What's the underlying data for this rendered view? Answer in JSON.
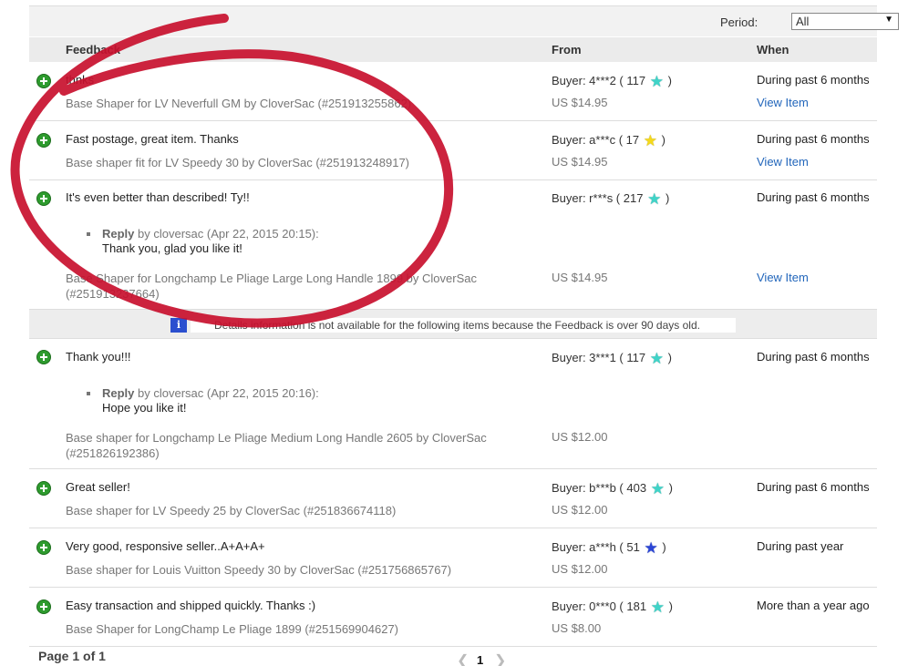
{
  "period": {
    "label": "Period:",
    "selected": "All"
  },
  "columns": {
    "feedback": "Feedback",
    "from": "From",
    "when": "When"
  },
  "rows": [
    {
      "comment": "thnks",
      "item": "Base Shaper for LV Neverfull GM by CloverSac (#251913255862)",
      "buyer": "Buyer: 4***2 ( 117",
      "buyer_close": ")",
      "star": "turquoise",
      "price": "US $14.95",
      "when": "During past 6 months",
      "link": "View Item"
    },
    {
      "comment": "Fast postage, great item. Thanks",
      "item": "Base shaper fit for LV Speedy 30 by CloverSac (#251913248917)",
      "buyer": "Buyer: a***c ( 17",
      "buyer_close": ")",
      "star": "yellow",
      "price": "US $14.95",
      "when": "During past 6 months",
      "link": "View Item"
    },
    {
      "comment": "It's even better than described! Ty!!",
      "reply_label": "Reply",
      "reply_meta": " by cloversac (Apr 22, 2015 20:15):",
      "reply_text": "Thank you, glad you like it!",
      "item": "Base Shaper for Longchamp Le Pliage Large Long Handle 1899 by CloverSac (#251913237664)",
      "buyer": "Buyer: r***s ( 217",
      "buyer_close": ")",
      "star": "turquoise",
      "price": "US $14.95",
      "when": "During past 6 months",
      "link": "View Item"
    },
    {
      "comment": "Thank you!!!",
      "reply_label": "Reply",
      "reply_meta": " by cloversac (Apr 22, 2015 20:16):",
      "reply_text": "Hope you like it!",
      "item": "Base shaper for Longchamp Le Pliage Medium Long Handle 2605 by CloverSac (#251826192386)",
      "buyer": "Buyer: 3***1 ( 117",
      "buyer_close": ")",
      "star": "turquoise",
      "price": "US $12.00",
      "when": "During past 6 months"
    },
    {
      "comment": "Great seller!",
      "item": "Base shaper for LV Speedy 25 by CloverSac (#251836674118)",
      "buyer": "Buyer: b***b ( 403",
      "buyer_close": ")",
      "star": "turquoise",
      "price": "US $12.00",
      "when": "During past 6 months"
    },
    {
      "comment": "Very good, responsive seller..A+A+A+",
      "item": "Base shaper for Louis Vuitton Speedy 30 by CloverSac (#251756865767)",
      "buyer": "Buyer: a***h ( 51",
      "buyer_close": ")",
      "star": "blue",
      "price": "US $12.00",
      "when": "During past year"
    },
    {
      "comment": "Easy transaction and shipped quickly. Thanks :)",
      "item": "Base Shaper for LongChamp Le Pliage 1899 (#251569904627)",
      "buyer": "Buyer: 0***0 ( 181",
      "buyer_close": ")",
      "star": "turquoise",
      "price": "US $8.00",
      "when": "More than a year ago"
    }
  ],
  "notice": {
    "icon": "info-icon",
    "text": "Details information is not available for the following items because the Feedback is over 90 days old."
  },
  "footer": {
    "page_text": "Page 1 of 1",
    "current_page": "1"
  },
  "colors": {
    "link": "#2266bb",
    "positive": "#2e9b2e",
    "annotation_ring": "#c8102e"
  }
}
